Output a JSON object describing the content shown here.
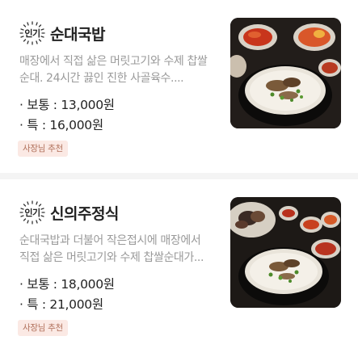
{
  "menu_items": [
    {
      "badge": "인기",
      "name": "순대국밥",
      "description": "매장에서 직접 삶은 머릿고기와 수제 찹쌀\n순대.  24시간 끓인 진한 사골육수....",
      "prices": [
        {
          "label": "· 보통 : 13,000원"
        },
        {
          "label": "· 특 : 16,000원"
        }
      ],
      "tag": "사장님 추천",
      "image_icon": "gukbap-photo"
    },
    {
      "badge": "인기",
      "name": "신의주정식",
      "description": "순대국밥과 더불어 작은접시에 매장에서\n직접 삶은 머릿고기와 수제 찹쌀순대가...",
      "prices": [
        {
          "label": "· 보통 : 18,000원"
        },
        {
          "label": "· 특 : 21,000원"
        }
      ],
      "tag": "사장님 추천",
      "image_icon": "set-meal-photo"
    }
  ],
  "colors": {
    "tag_bg": "#fbe9e4",
    "tag_text": "#b0705a",
    "divider": "#f4f4f4"
  }
}
